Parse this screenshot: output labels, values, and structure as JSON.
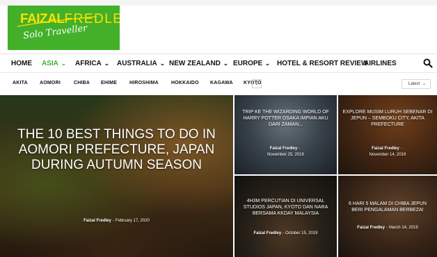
{
  "logo": {
    "brand_part1": "FAIZAL",
    "brand_part2": "FREDLEY",
    "tagline": "Solo Traveller"
  },
  "colors": {
    "brand_green": "#43b02a",
    "brand_yellow": "#ffe000",
    "text": "#111111"
  },
  "main_nav": {
    "items": [
      {
        "label": "HOME"
      },
      {
        "label": "ASIA"
      },
      {
        "label": "AFRICA"
      },
      {
        "label": "AUSTRALIA"
      },
      {
        "label": "NEW ZEALAND"
      },
      {
        "label": "EUROPE"
      },
      {
        "label": "HOTEL & RESORT REVIEW"
      },
      {
        "label": "AIRLINES"
      }
    ],
    "active": "ASIA",
    "search_icon": "search-icon"
  },
  "sub_nav": {
    "items": [
      "AKITA",
      "AOMORI",
      "CHIBA",
      "EHIME",
      "HIROSHIMA",
      "HOKKAIDO",
      "KAGAWA",
      "KYOTO"
    ],
    "more_icon": "chevron-down-icon",
    "sort": {
      "value": "Latest"
    }
  },
  "featured": {
    "title": "THE 10 BEST THINGS TO DO IN AOMORI PREFECTURE, JAPAN DURING AUTUMN SEASON",
    "author": "Faizal Fredley",
    "separator": "-",
    "date": "February 17, 2020"
  },
  "posts": [
    {
      "title": "TRIP KE THE WIZARDING WORLD OF HARRY POTTER OSAKA IMPIAN AKU DARI ZAMAN...",
      "author": "Faizal Fredley",
      "separator": "-",
      "date": "November 25, 2019"
    },
    {
      "title": "EXPLORE MUSIM LURUH SEBENAR DI JEPUN – SEMBOKU CITY, AKITA PREFECTURE",
      "author": "Faizal Fredley",
      "separator": "-",
      "date": "November 14, 2019"
    },
    {
      "title": "4H3M PERCUTIAN DI UNIVERSAL STUDIOS JAPAN, KYOTO DAN NARA BERSAMA KKDAY MALAYSIA",
      "author": "Faizal Fredley",
      "separator": "-",
      "date": "October 15, 2019"
    },
    {
      "title": "6 HARI 5 MALAM DI CHIBA JEPUN BERI PENGALAMAN BERBEZA!",
      "author": "Faizal Fredley",
      "separator": "-",
      "date": "March 14, 2019"
    }
  ]
}
